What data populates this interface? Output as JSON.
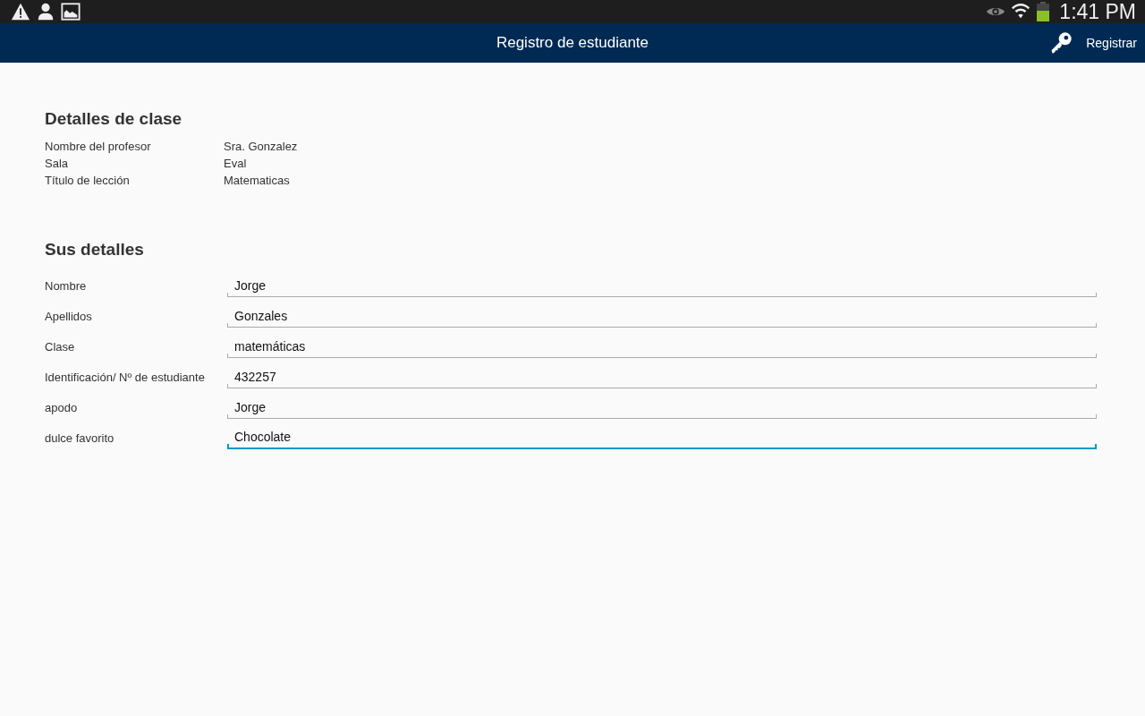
{
  "status_bar": {
    "time": "1:41 PM"
  },
  "action_bar": {
    "title": "Registro de estudiante",
    "action": "Registrar"
  },
  "class_details": {
    "heading": "Detalles de clase",
    "rows": [
      {
        "label": "Nombre del profesor",
        "value": "Sra. Gonzalez"
      },
      {
        "label": "Sala",
        "value": "Eval"
      },
      {
        "label": "Título de lección",
        "value": "Matematicas"
      }
    ]
  },
  "your_details": {
    "heading": "Sus detalles",
    "fields": [
      {
        "label": "Nombre",
        "value": "Jorge",
        "focused": false
      },
      {
        "label": "Apellidos",
        "value": "Gonzales",
        "focused": false
      },
      {
        "label": "Clase",
        "value": "matemáticas",
        "focused": false
      },
      {
        "label": "Identificación/ Nº de estudiante",
        "value": "432257",
        "focused": false
      },
      {
        "label": "apodo",
        "value": "Jorge",
        "focused": false
      },
      {
        "label": "dulce favorito",
        "value": "Chocolate",
        "focused": true
      }
    ]
  }
}
